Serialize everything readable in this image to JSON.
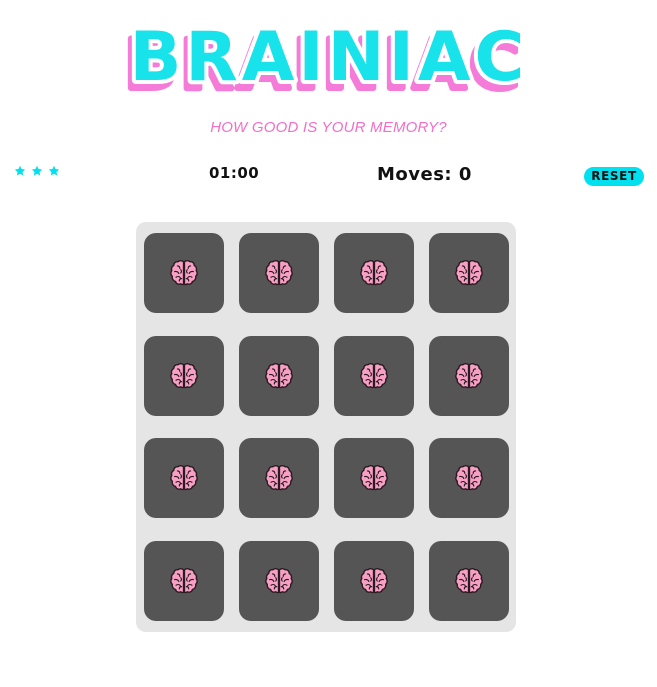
{
  "header": {
    "title": "BRAINIAC",
    "subtitle": "HOW GOOD IS YOUR MEMORY?",
    "title_colors": {
      "fill": "#19e3ea",
      "shadow": "#f57bd9",
      "outline": "#ffffff"
    }
  },
  "score_panel": {
    "stars": [
      {
        "icon": "star-icon",
        "filled": true
      },
      {
        "icon": "star-icon",
        "filled": true
      },
      {
        "icon": "star-icon",
        "filled": true
      }
    ],
    "star_color": "#00e0ee",
    "timer": "01:00",
    "moves_label": "Moves: 0",
    "reset_label": "RESET",
    "reset_color": "#00e0ee"
  },
  "board": {
    "rows": 4,
    "cols": 4,
    "card_back_icon": "brain-icon",
    "card_color": "#555555",
    "board_color": "#e5e5e5",
    "brain_color": "#f7a0c4",
    "cards": [
      {
        "state": "face-down"
      },
      {
        "state": "face-down"
      },
      {
        "state": "face-down"
      },
      {
        "state": "face-down"
      },
      {
        "state": "face-down"
      },
      {
        "state": "face-down"
      },
      {
        "state": "face-down"
      },
      {
        "state": "face-down"
      },
      {
        "state": "face-down"
      },
      {
        "state": "face-down"
      },
      {
        "state": "face-down"
      },
      {
        "state": "face-down"
      },
      {
        "state": "face-down"
      },
      {
        "state": "face-down"
      },
      {
        "state": "face-down"
      },
      {
        "state": "face-down"
      }
    ]
  }
}
